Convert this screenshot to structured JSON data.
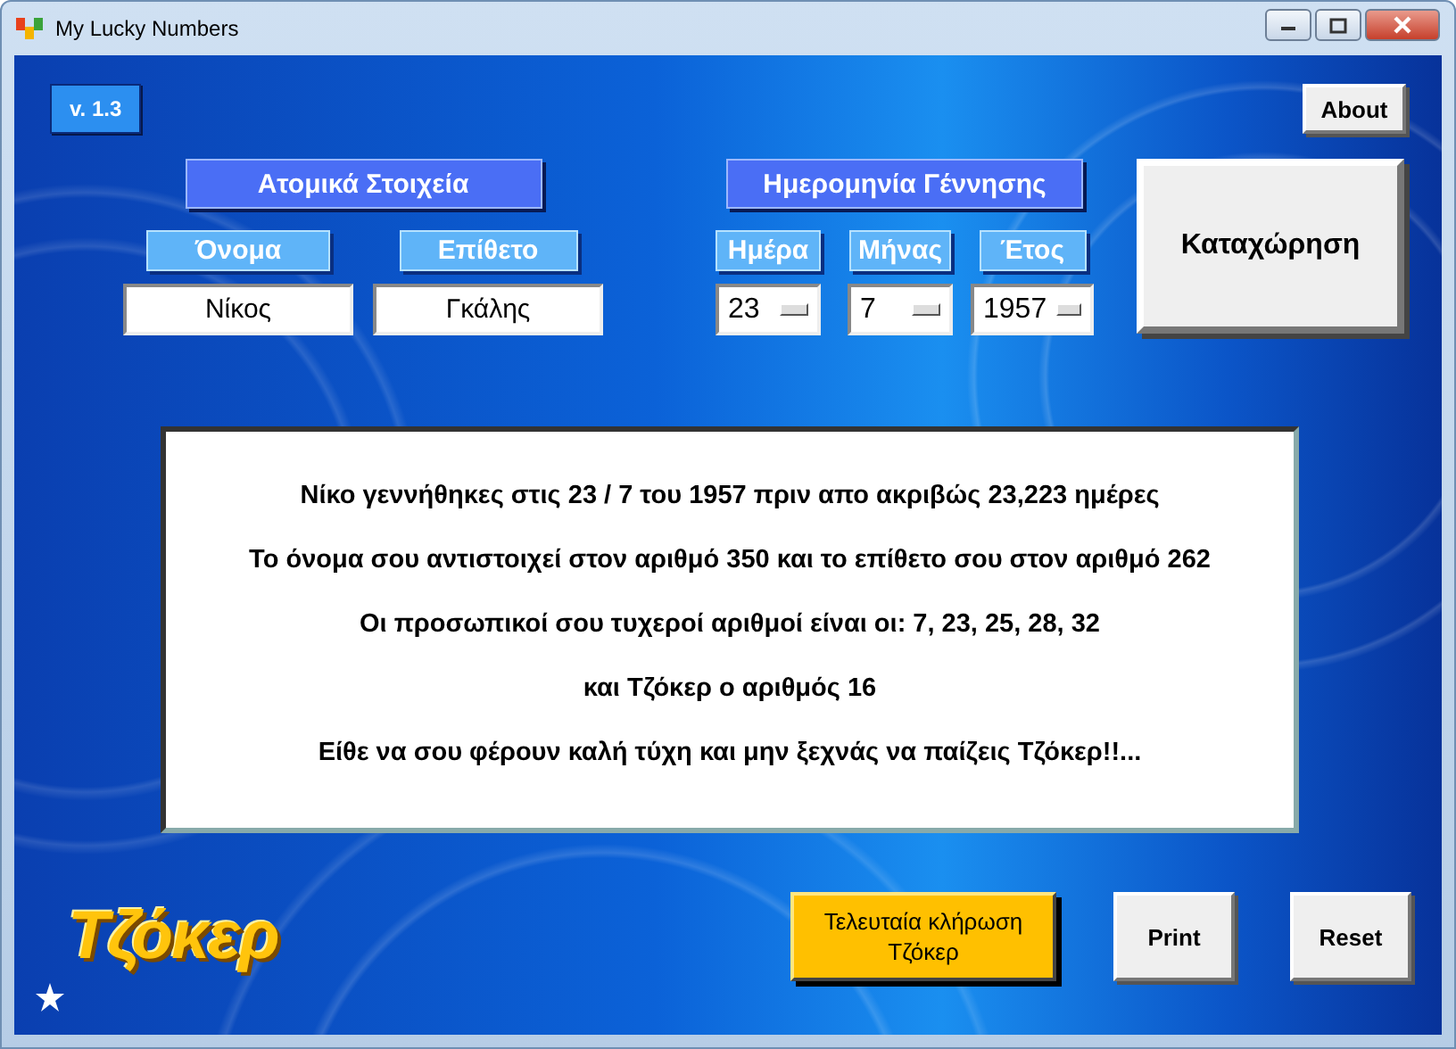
{
  "window": {
    "title": "My Lucky Numbers"
  },
  "version": "v. 1.3",
  "about_button": "About",
  "personal": {
    "header": "Ατομικά Στοιχεία",
    "fields": [
      {
        "label": "Όνομα",
        "value": "Νίκος"
      },
      {
        "label": "Επίθετο",
        "value": "Γκάλης"
      }
    ]
  },
  "birth": {
    "header": "Ημερομηνία Γέννησης",
    "fields": [
      {
        "label": "Ημέρα",
        "value": "23"
      },
      {
        "label": "Μήνας",
        "value": "7"
      },
      {
        "label": "Έτος",
        "value": "1957"
      }
    ]
  },
  "submit_button": "Καταχώρηση",
  "result_lines": [
    "Νίκο γεννήθηκες στις 23 / 7 του 1957 πριν απο ακριβώς 23,223 ημέρες",
    "Το όνομα σου αντιστοιχεί στον αριθμό 350 και το επίθετο σου στον αριθμό 262",
    "Οι προσωπικοί σου τυχεροί αριθμοί είναι οι: 7, 23, 25, 28, 32",
    "και Τζόκερ ο αριθμός 16",
    "Είθε να σου φέρουν καλή τύχη και μην ξεχνάς να παίζεις Τζόκερ!!..."
  ],
  "logo": "Τζόκερ",
  "buttons": [
    {
      "label": "Τελευταία κλήρωση Τζόκερ",
      "kind": "highlight"
    },
    {
      "label": "Print",
      "kind": "plain"
    },
    {
      "label": "Reset",
      "kind": "plain"
    }
  ]
}
